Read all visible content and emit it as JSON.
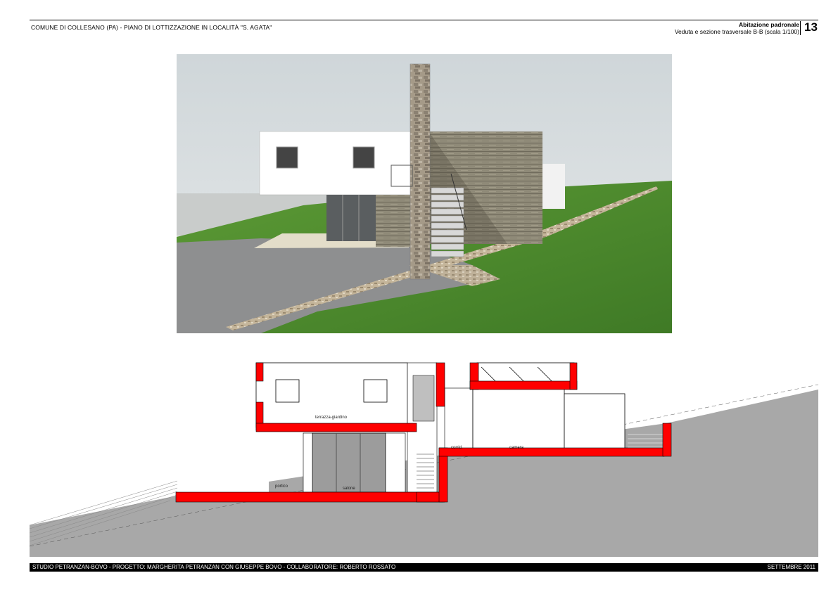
{
  "header": {
    "project_title": "COMUNE DI COLLESANO (PA) - PIANO DI LOTTIZZAZIONE IN LOCALITÀ \"S. AGATA\"",
    "sheet_title": "Abitazione padronale",
    "sheet_subtitle": "Veduta e sezione trasversale B-B (scala 1/100)",
    "page_number": "13"
  },
  "section_labels": {
    "terrace": "terrazza-giardino",
    "corridor": "corrid.",
    "bedroom": "camera",
    "portico": "portico",
    "living_room": "salone"
  },
  "footer": {
    "credits": "STUDIO PETRANZAN-BOVO - PROGETTO: MARGHERITA PETRANZAN CON GIUSEPPE BOVO - COLLABORATORE: ROBERTO ROSSATO",
    "date": "SETTEMBRE 2011"
  },
  "colors": {
    "section_cut": "#ff0000",
    "ground": "#a8a8a8",
    "grass": "#4f8a2e",
    "sky": "#d9dfe2"
  }
}
